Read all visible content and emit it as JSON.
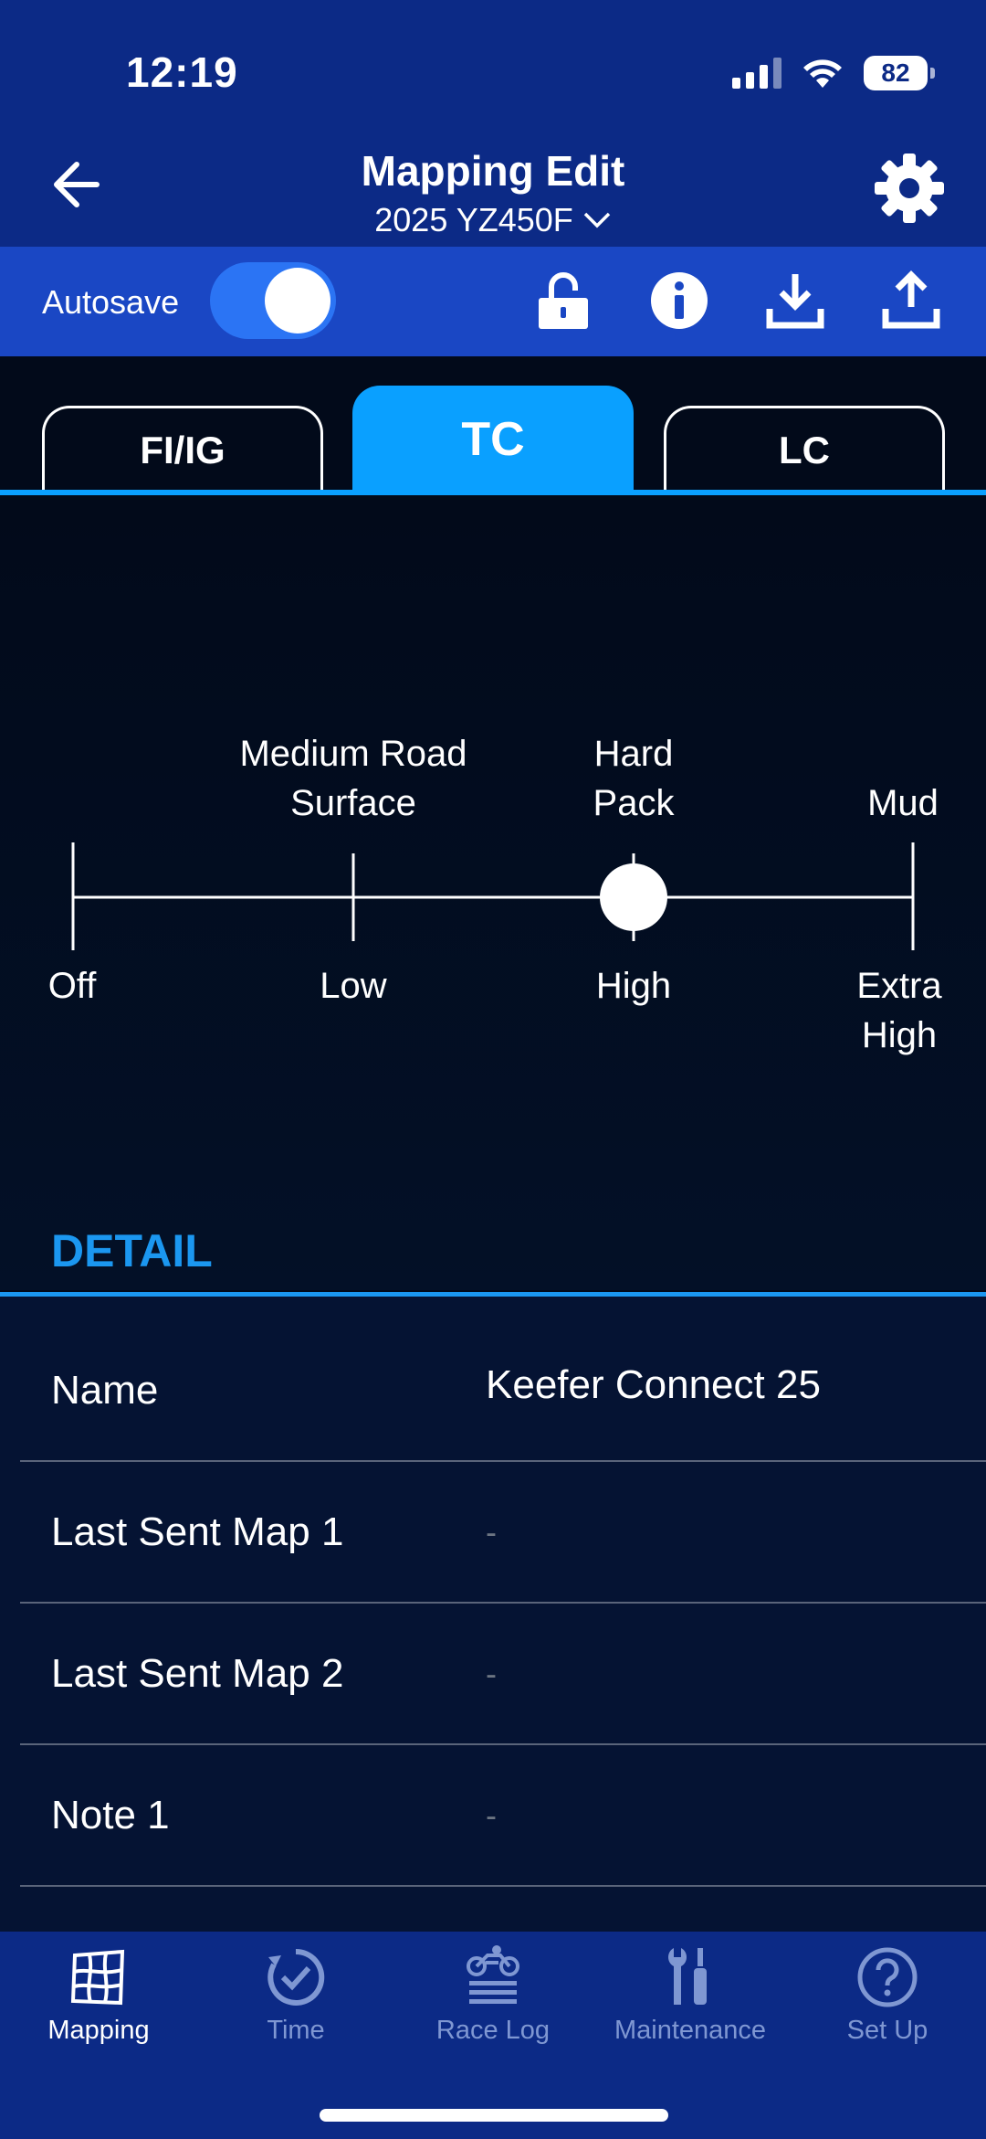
{
  "status_bar": {
    "time": "12:19",
    "battery": "82"
  },
  "header": {
    "title": "Mapping Edit",
    "subtitle": "2025 YZ450F"
  },
  "toolbar": {
    "autosave_label": "Autosave",
    "autosave_on": true
  },
  "tabs": [
    {
      "label": "FI/IG",
      "active": false
    },
    {
      "label": "TC",
      "active": true
    },
    {
      "label": "LC",
      "active": false
    }
  ],
  "traction_control": {
    "top_labels": [
      "Medium Road\nSurface",
      "Hard\nPack",
      "Mud"
    ],
    "bottom_labels": [
      "Off",
      "Low",
      "High",
      "Extra\nHigh"
    ],
    "selected_level": "High",
    "selected_index": 2
  },
  "detail": {
    "heading": "DETAIL",
    "rows": [
      {
        "label": "Name",
        "value": "Keefer Connect 25"
      },
      {
        "label": "Last Sent Map 1",
        "value": "-"
      },
      {
        "label": "Last Sent Map 2",
        "value": "-"
      },
      {
        "label": "Note 1",
        "value": "-"
      }
    ]
  },
  "nav": [
    {
      "label": "Mapping",
      "icon": "map-grid-icon",
      "active": true
    },
    {
      "label": "Time",
      "icon": "stopwatch-icon",
      "active": false
    },
    {
      "label": "Race Log",
      "icon": "motorbike-log-icon",
      "active": false
    },
    {
      "label": "Maintenance",
      "icon": "tools-icon",
      "active": false
    },
    {
      "label": "Set Up",
      "icon": "help-circle-icon",
      "active": false
    }
  ],
  "colors": {
    "header_blue": "#0c2a86",
    "toolbar_blue": "#1a47c4",
    "accent": "#0aa0ff",
    "detail_blue": "#1b97f0"
  }
}
